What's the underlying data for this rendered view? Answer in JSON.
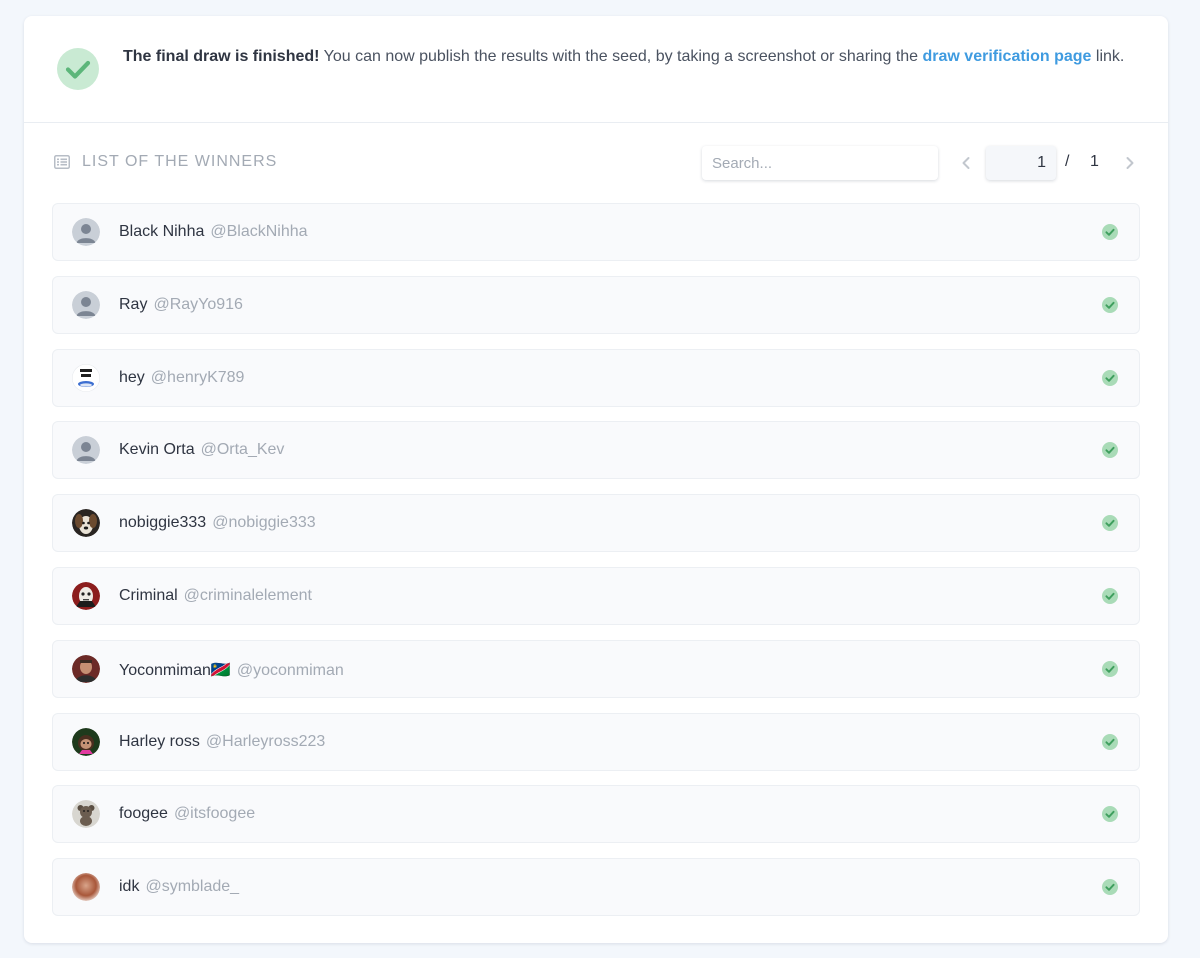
{
  "banner": {
    "bold": "The final draw is finished!",
    "text": " You can now publish the results with the seed, by taking a screenshot or sharing the ",
    "link": "draw verification page",
    "tail": " link.",
    "icon": "check-circle-icon",
    "color": "#5cb67a"
  },
  "list": {
    "title": "LIST OF THE WINNERS",
    "icon": "list-icon",
    "search_placeholder": "Search...",
    "pager": {
      "current": "1",
      "separator": "/",
      "total": "1"
    }
  },
  "winners": [
    {
      "name": "Black Nihha",
      "handle": "@BlackNihha",
      "avatar": "default-avatar"
    },
    {
      "name": "Ray",
      "handle": "@RayYo916",
      "avatar": "default-avatar"
    },
    {
      "name": "hey",
      "handle": "@henryK789",
      "avatar": "got-em-avatar"
    },
    {
      "name": "Kevin Orta",
      "handle": "@Orta_Kev",
      "avatar": "default-avatar"
    },
    {
      "name": "nobiggie333",
      "handle": "@nobiggie333",
      "avatar": "dog-avatar"
    },
    {
      "name": "Criminal",
      "handle": "@criminalelement",
      "avatar": "masked-avatar"
    },
    {
      "name": "Yoconmiman🇳🇦",
      "handle": "@yoconmiman",
      "avatar": "photo-avatar"
    },
    {
      "name": "Harley ross",
      "handle": "@Harleyross223",
      "avatar": "cartoon-avatar"
    },
    {
      "name": "foogee",
      "handle": "@itsfoogee",
      "avatar": "bear-avatar"
    },
    {
      "name": "idk",
      "handle": "@symblade_",
      "avatar": "blurred-avatar"
    }
  ]
}
